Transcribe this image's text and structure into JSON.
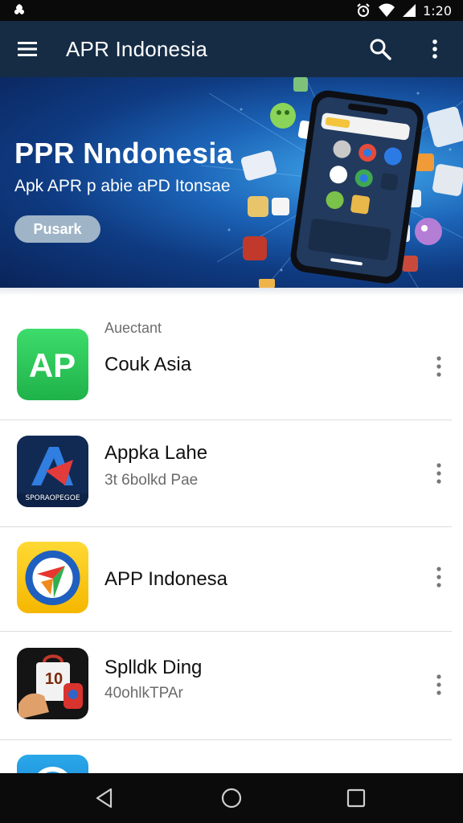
{
  "status_bar": {
    "time": "1:20",
    "icons": [
      "app-notification-icon",
      "alarm-icon",
      "wifi-icon",
      "signal-icon"
    ]
  },
  "app_bar": {
    "title": "APR Indonesia",
    "icons": [
      "menu-icon",
      "search-icon",
      "more-vert-icon"
    ]
  },
  "banner": {
    "title": "PPR Nndonesia",
    "subtitle": "Apk APR p abie aPD Itonsae",
    "button_label": "Pusark"
  },
  "list": {
    "items": [
      {
        "overline": "Auectant",
        "title": "Couk Asia",
        "subtitle": "",
        "icon": "ap-app-icon"
      },
      {
        "overline": "",
        "title": "Appka Lahe",
        "subtitle": "3t 6bolkd Pae",
        "icon": "appka-app-icon",
        "icon_caption": "SPORAOPEGOE"
      },
      {
        "overline": "",
        "title": "APP Indonesa",
        "subtitle": "",
        "icon": "app-indonesa-icon"
      },
      {
        "overline": "",
        "title": "Splldk Ding",
        "subtitle": "40ohlkTPAr",
        "icon": "shopping-app-icon",
        "icon_caption": "10"
      }
    ]
  },
  "colors": {
    "app_bar": "#162c45",
    "banner_primary": "#1c64b8",
    "banner_button": "#9fb4c7",
    "status_bar": "#0a0a0a",
    "nav_bar": "#0b0b0b"
  },
  "nav_bar": {
    "icons": [
      "back-icon",
      "home-icon",
      "recents-icon"
    ]
  }
}
